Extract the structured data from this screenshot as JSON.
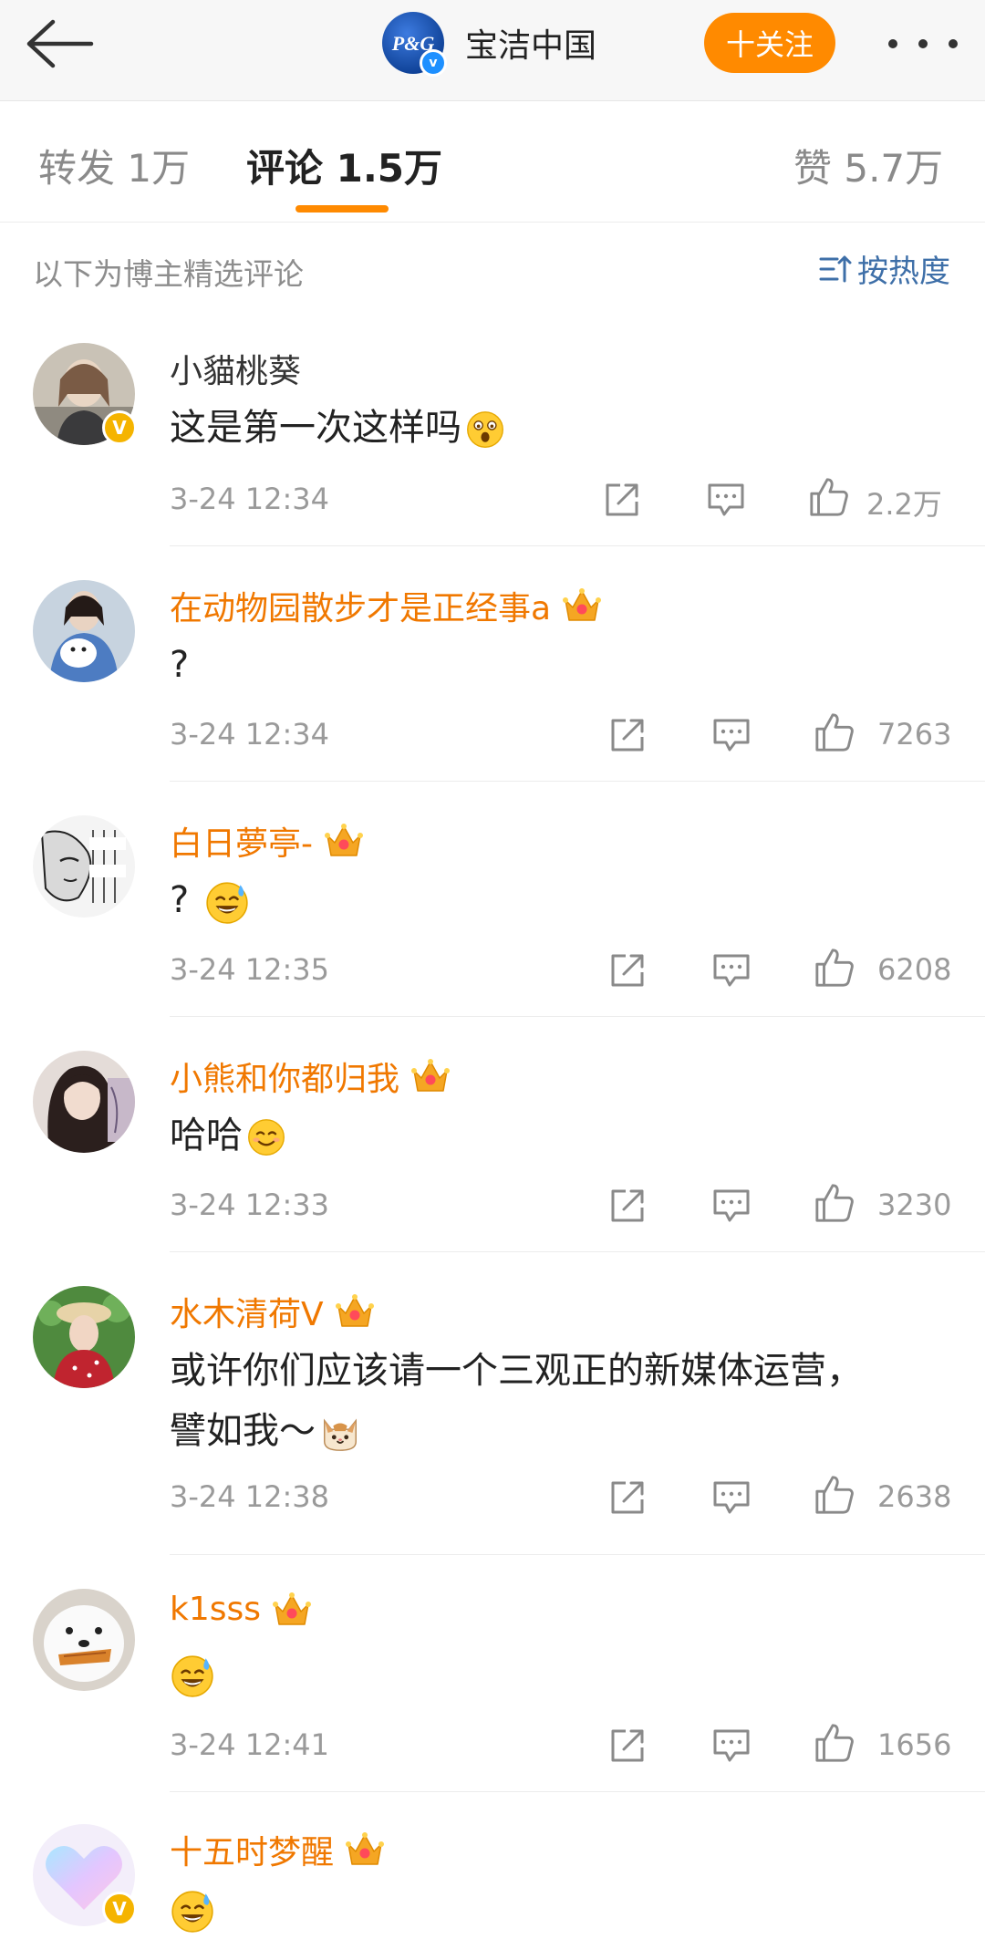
{
  "header": {
    "brand_name": "宝洁中国",
    "brand_logo_text": "P&G",
    "follow_label": "十关注",
    "back_icon": "back-arrow-icon",
    "more_icon": "more-dots-icon"
  },
  "tabs": [
    {
      "label": "转发 1万"
    },
    {
      "label": "评论 1.5万"
    },
    {
      "label": "赞 5.7万"
    }
  ],
  "sort": {
    "caption": "以下为博主精选评论",
    "toggle_label": "按热度"
  },
  "comments": [
    {
      "name": "小貓桃葵",
      "text": "这是第一次这样吗",
      "emoji": "shocked-emoji",
      "time": "3-24 12:34",
      "likes": "2.2万"
    },
    {
      "name": "在动物园散步才是正经事a",
      "text": "?",
      "emoji": "",
      "time": "3-24 12:34",
      "likes": "7263"
    },
    {
      "name": "白日夢亭-",
      "text": "?",
      "emoji": "sweat-smile-emoji",
      "time": "3-24 12:35",
      "likes": "6208"
    },
    {
      "name": "小熊和你都归我",
      "text": "哈哈",
      "emoji": "smile-emoji",
      "time": "3-24 12:33",
      "likes": "3230"
    },
    {
      "name": "水木清荷V",
      "text": "或许你们应该请一个三观正的新媒体运营，",
      "text2": "譬如我～",
      "emoji": "cat-emoji",
      "time": "3-24 12:38",
      "likes": "2638"
    },
    {
      "name": "k1sss",
      "text": "",
      "emoji": "sweat-smile-emoji",
      "time": "3-24 12:41",
      "likes": "1656"
    },
    {
      "name": "十五时梦醒",
      "text": "",
      "emoji": "sweat-smile-emoji",
      "time": "",
      "likes": ""
    }
  ],
  "colors": {
    "accent": "#ff8a00",
    "vip_name": "#f07800",
    "link_blue": "#3e6fa8",
    "meta_gray": "#9a9a9a"
  }
}
